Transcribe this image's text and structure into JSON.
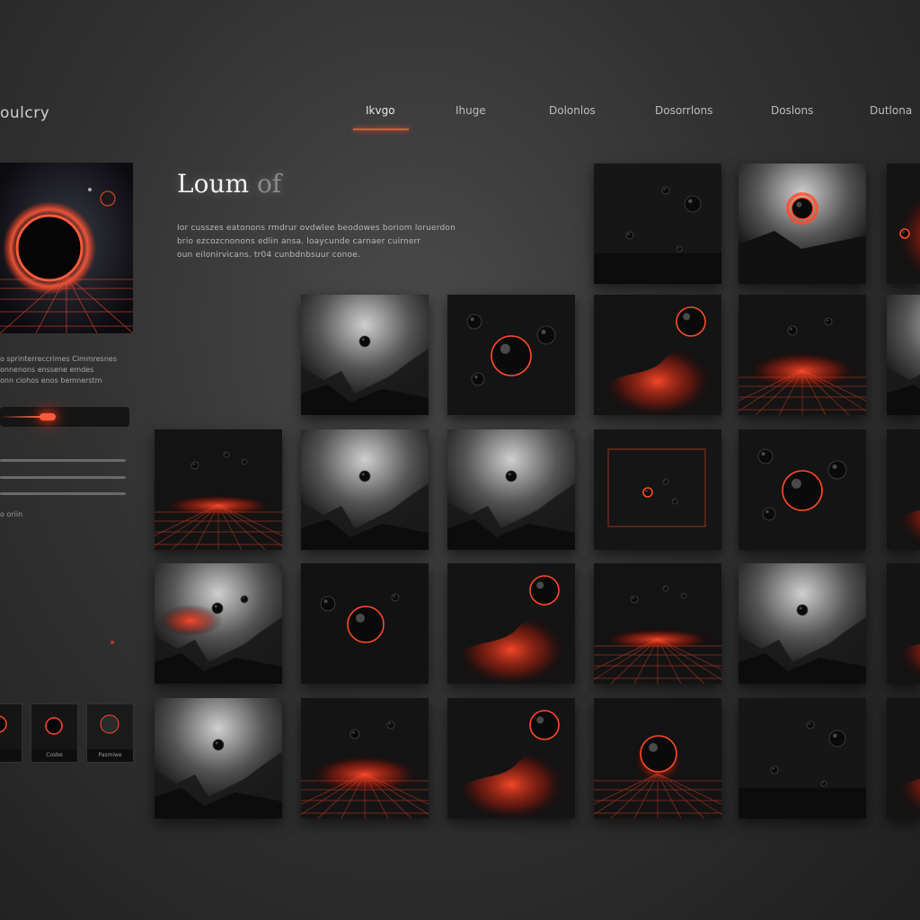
{
  "app": {
    "brand": "oulcry"
  },
  "nav": {
    "tabs": [
      "Ikvgo",
      "Ihuge",
      "Dolonlos",
      "Dosorrlons",
      "Doslons",
      "Dutlona"
    ],
    "active": 0
  },
  "hero": {
    "title": "Loum",
    "title_suffix": "of",
    "description": [
      "Ior cusszes eatonons rmdrur ovdwlee beodowes boriom loruerdon",
      "brio ezcozcnonons edlin ansa. loaycunde carnaer cuirnerr",
      "oun eilonirvicans. tr04 cunbdnbsuur conoe."
    ]
  },
  "sidebar": {
    "lines": [
      "o sprinterreccrimes Cimmresnes",
      "onnenons enssene emdes",
      "onn ciohos enos bemnerstm"
    ],
    "slider_value": 0.35,
    "label": "o oriin",
    "thumbs": [
      {
        "caption": ""
      },
      {
        "caption": "Cosbe"
      },
      {
        "caption": "Pasmiwe"
      }
    ]
  },
  "gallery": {
    "accent": "#ff4a2a",
    "tiles": [
      "dark-orbs",
      "eclipse-mist",
      "red-flare",
      "misty-valley",
      "glow-orb",
      "red-nebula",
      "nebula-grid",
      "misty-valley",
      "grid-horizon",
      "misty-valley",
      "misty-valley",
      "framed-sparks",
      "glow-orb",
      "red-nebula",
      "misty-red",
      "dark-orb-red",
      "red-nebula",
      "grid-horizon",
      "misty-valley",
      "red-nebula",
      "misty-valley",
      "nebula-grid",
      "red-nebula",
      "eclipse-grid",
      "dark-orbs",
      "red-nebula"
    ]
  }
}
